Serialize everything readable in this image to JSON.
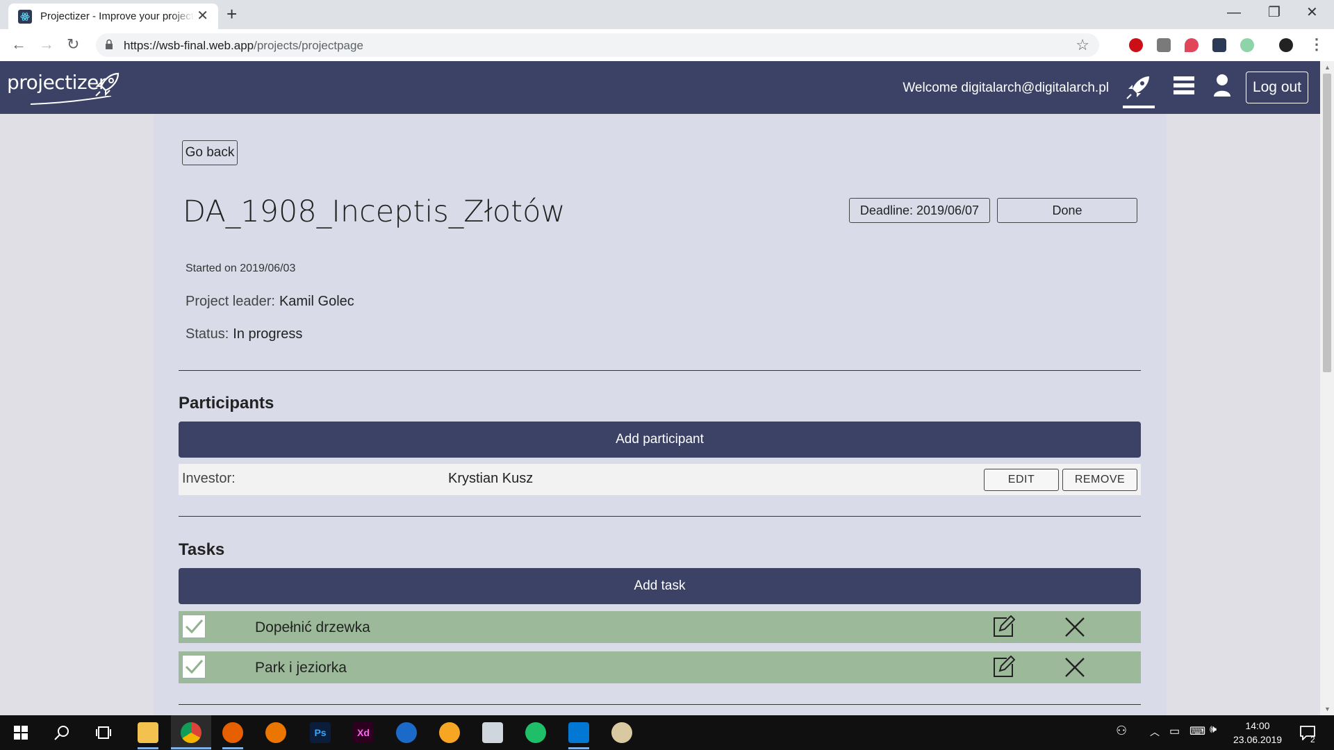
{
  "browser": {
    "tab_title": "Projectizer - Improve your projects",
    "tab_close": "✕",
    "new_tab": "+",
    "url_domain": "https://wsb-final.web.app",
    "url_path": "/projects/projectpage",
    "ext_colors": [
      "#cc0f16",
      "#7a7a7a",
      "#e0455a",
      "#2d3a55",
      "#8fd3a8"
    ]
  },
  "app": {
    "logo": "projectizer",
    "welcome": "Welcome digitalarch@digitalarch.pl",
    "logout": "Log out",
    "nav_icons": [
      "rocket-icon",
      "list-icon",
      "user-icon"
    ],
    "colors": {
      "navbar": "#3b4265",
      "task_row": "#9cba9a",
      "content_bg": "#dadbe8"
    }
  },
  "project": {
    "go_back": "Go back",
    "title": "DA_1908_Inceptis_Złotów",
    "deadline": "Deadline: 2019/06/07",
    "done": "Done",
    "started": "Started on 2019/06/03",
    "leader_label": "Project leader:",
    "leader": "Kamil Golec",
    "status_label": "Status:",
    "status": "In progress"
  },
  "participants": {
    "title": "Participants",
    "add_label": "Add participant",
    "items": [
      {
        "role": "Investor:",
        "name": "Krystian Kusz",
        "edit": "EDIT",
        "remove": "REMOVE"
      }
    ]
  },
  "tasks": {
    "title": "Tasks",
    "add_label": "Add task",
    "items": [
      {
        "text": "Dopełnić drzewka",
        "done": true
      },
      {
        "text": "Park i jeziorka",
        "done": true
      }
    ]
  },
  "taskbar": {
    "time": "14:00",
    "date": "23.06.2019",
    "notifications": "2"
  }
}
